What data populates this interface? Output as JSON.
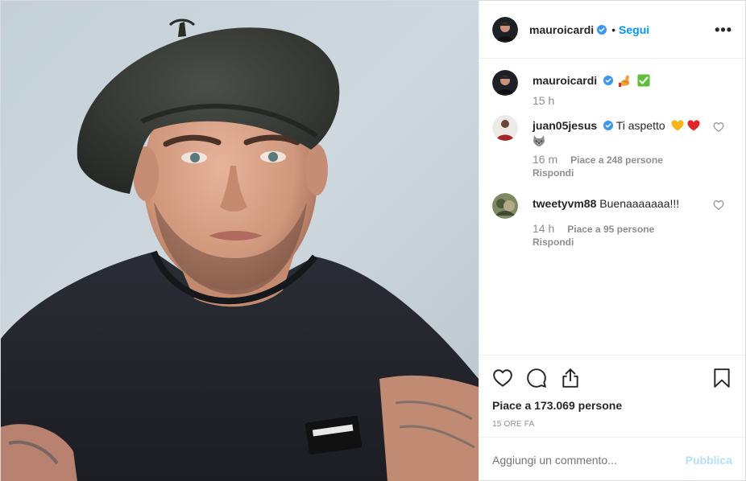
{
  "header": {
    "username": "mauroicardi",
    "separator": "•",
    "follow_label": "Segui",
    "more_label": "•••"
  },
  "caption": {
    "username": "mauroicardi",
    "time": "15 h"
  },
  "comments": [
    {
      "username": "juan05jesus",
      "text": "Ti aspetto",
      "time": "16 m",
      "likes": "Piace a 248 persone",
      "reply": "Rispondi"
    },
    {
      "username": "tweetyvm88",
      "text": "Buenaaaaaaa!!!",
      "time": "14 h",
      "likes": "Piace a 95 persone",
      "reply": "Rispondi"
    }
  ],
  "actions": {
    "likes_total": "Piace a 173.069 persone",
    "posted_ago": "15 ORE FA"
  },
  "add_comment": {
    "placeholder": "Aggiungi un commento...",
    "publish_label": "Pubblica"
  },
  "colors": {
    "accent": "#0095f6",
    "publish_disabled": "#b2dffc",
    "verified": "#3897f0",
    "muted": "#8e8e8e"
  }
}
